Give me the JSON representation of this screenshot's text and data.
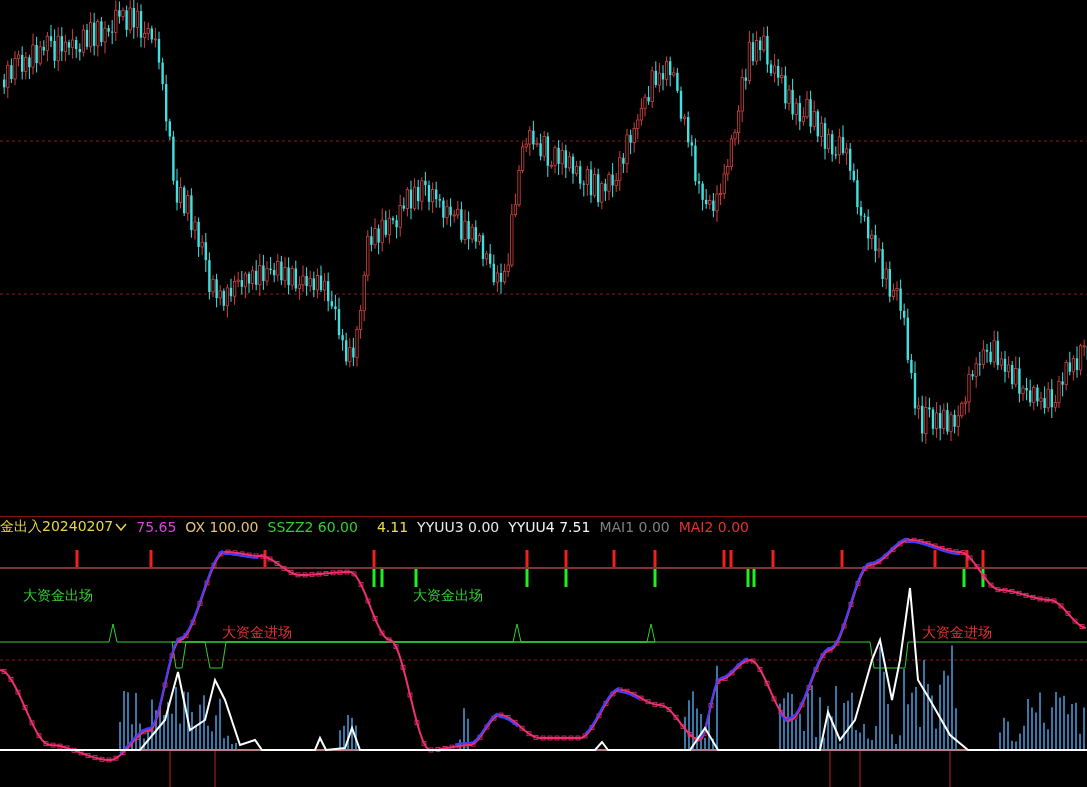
{
  "indicator_header": {
    "title": "金出入20240207",
    "color": "#e8d44a",
    "values": [
      {
        "text": "75.65",
        "color": "#e040e0"
      },
      {
        "text": "OX 100.00",
        "color": "#e8c07a"
      },
      {
        "text": "SSZZ2 60.00",
        "color": "#30d030"
      },
      {
        "text": "4.11",
        "color": "#e8e040"
      },
      {
        "text": "YYUU3 0.00",
        "color": "#e8e8e8"
      },
      {
        "text": "YYUU4 7.51",
        "color": "#f4f4f4"
      },
      {
        "text": "MAI1 0.00",
        "color": "#808080"
      },
      {
        "text": "MAI2 0.00",
        "color": "#e83030"
      }
    ]
  },
  "indicator_labels": [
    {
      "text": "大资金出场",
      "color": "#30d030"
    },
    {
      "text": "大资金进场",
      "color": "#e83030"
    },
    {
      "text": "大资金出场",
      "color": "#30d030"
    },
    {
      "text": "大资金进场",
      "color": "#e83030"
    }
  ]
}
